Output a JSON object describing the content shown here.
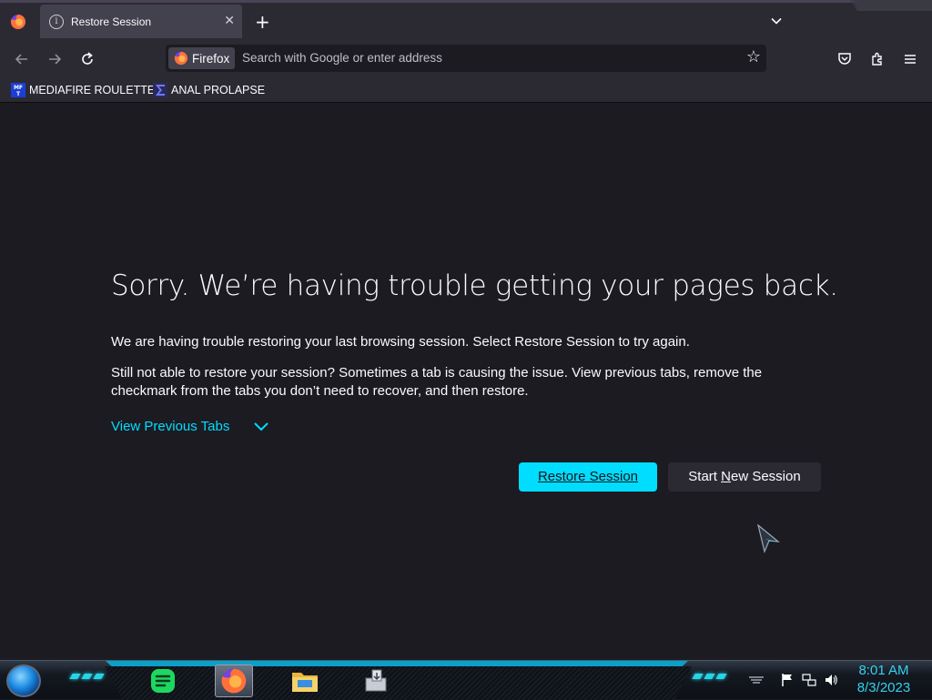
{
  "browser": {
    "tab": {
      "title": "Restore Session",
      "close_glyph": "✕"
    },
    "new_tab_glyph": "+",
    "identity_label": "Firefox",
    "url_placeholder": "Search with Google or enter address",
    "bookmarks": [
      {
        "label": "MEDIAFIRE ROULETTER",
        "icon": "mediafire-favicon",
        "favicon_text": "MF T"
      },
      {
        "label": "ANAL PROLAPSE",
        "icon": "sigma-favicon"
      }
    ]
  },
  "page": {
    "title": "Sorry. We’re having trouble getting your pages back.",
    "paragraph1": "We are having trouble restoring your last browsing session. Select Restore Session to try again.",
    "paragraph2": "Still not able to restore your session? Sometimes a tab is causing the issue. View previous tabs, remove the checkmark from the tabs you don’t need to recover, and then restore.",
    "view_tabs_label": "View Previous Tabs",
    "restore_button": "Restore Session",
    "new_session_button": {
      "before": "Start ",
      "accesskey": "N",
      "after": "ew Session"
    }
  },
  "taskbar": {
    "apps": [
      "spotify",
      "firefox",
      "file-explorer",
      "installer"
    ],
    "active_app": "firefox",
    "time": "8:01 AM",
    "date": "8/3/2023"
  },
  "colors": {
    "accent": "#00ddff",
    "page_bg": "#1c1b22",
    "toolbar_bg": "#2b2a33",
    "clock": "#32d2ee"
  }
}
